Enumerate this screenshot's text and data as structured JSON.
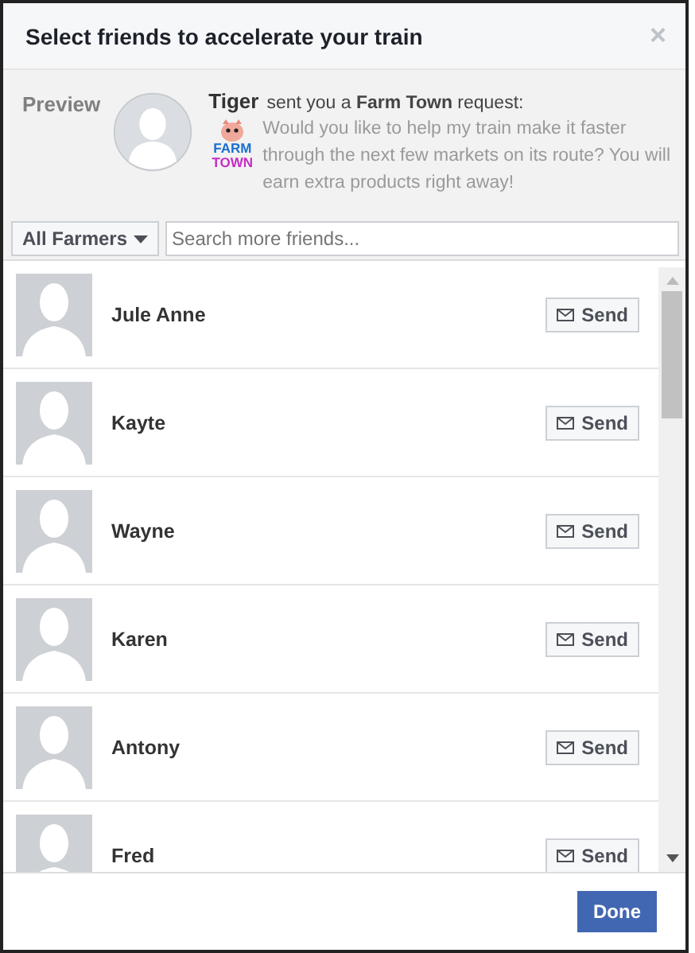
{
  "dialog": {
    "title": "Select friends to accelerate your train",
    "close": "×"
  },
  "preview": {
    "label": "Preview",
    "sender": "Tiger",
    "request": "sent you a **Farm Town** request:",
    "message": "Would you like to help my train make it faster through the next few markets on its route? You will earn extra products right away!",
    "logo_lines": [
      "FARM",
      "TOWN"
    ]
  },
  "filter": {
    "dropdown": "All Farmers",
    "placeholder": "Search more friends..."
  },
  "friends": [
    {
      "name": "Jule Anne",
      "button": "Send"
    },
    {
      "name": "Kayte",
      "button": "Send"
    },
    {
      "name": "Wayne",
      "button": "Send"
    },
    {
      "name": "Karen",
      "button": "Send"
    },
    {
      "name": "Antony",
      "button": "Send"
    },
    {
      "name": "Fred",
      "button": "Send"
    }
  ],
  "footer": {
    "button": "Done"
  }
}
